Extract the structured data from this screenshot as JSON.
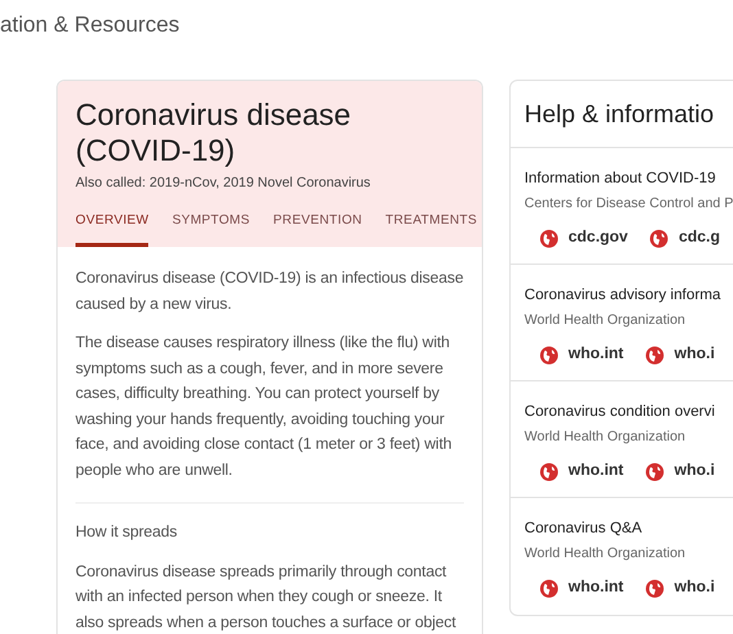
{
  "page_heading": "ation & Resources",
  "topic_card": {
    "title": "Coronavirus disease (COVID-19)",
    "also_called": "Also called: 2019-nCov, 2019 Novel Coronavirus",
    "tabs": [
      {
        "label": "OVERVIEW",
        "selected": true
      },
      {
        "label": "SYMPTOMS",
        "selected": false
      },
      {
        "label": "PREVENTION",
        "selected": false
      },
      {
        "label": "TREATMENTS",
        "selected": false
      }
    ],
    "paragraphs": [
      "Coronavirus disease (COVID-19) is an infectious disease caused by a new virus.",
      "The disease causes respiratory illness (like the flu) with symptoms such as a cough, fever, and in more severe cases, difficulty breathing. You can protect yourself by washing your hands frequently, avoiding touching your face, and avoiding close contact (1 meter or 3 feet) with people who are unwell."
    ],
    "section_heading": "How it spreads",
    "section_text": "Coronavirus disease spreads primarily through contact with an infected person when they cough or sneeze. It also spreads when a person touches a surface or object"
  },
  "help_card": {
    "title": "Help & informatio",
    "resources": [
      {
        "title": "Information about COVID-19",
        "source": "Centers for Disease Control and P",
        "links": [
          "cdc.gov",
          "cdc.g"
        ]
      },
      {
        "title": "Coronavirus advisory informa",
        "source": "World Health Organization",
        "links": [
          "who.int",
          "who.i"
        ]
      },
      {
        "title": "Coronavirus condition overvi",
        "source": "World Health Organization",
        "links": [
          "who.int",
          "who.i"
        ]
      },
      {
        "title": "Coronavirus Q&A",
        "source": "World Health Organization",
        "links": [
          "who.int",
          "who.i"
        ]
      }
    ]
  }
}
